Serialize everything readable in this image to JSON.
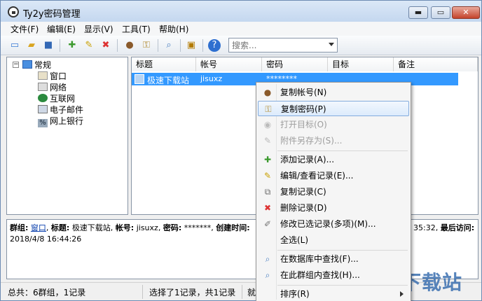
{
  "window": {
    "title": "Ty2y密码管理"
  },
  "title_buttons": {
    "minimize": "▬",
    "maximize": "▭",
    "close": "✕"
  },
  "menu": [
    "文件(F)",
    "编辑(E)",
    "显示(V)",
    "工具(T)",
    "帮助(H)"
  ],
  "toolbar": {
    "icons": [
      "new-file-icon",
      "open-folder-icon",
      "save-icon",
      "add-record-icon",
      "edit-record-icon",
      "delete-record-icon",
      "user-icon",
      "key-icon",
      "find-icon",
      "lock-icon",
      "help-icon"
    ],
    "search_placeholder": "搜索..."
  },
  "tree": {
    "root": "常规",
    "children": [
      "窗口",
      "网络",
      "互联网",
      "电子邮件",
      "网上银行"
    ]
  },
  "list": {
    "columns": [
      "标题",
      "帐号",
      "密码",
      "目标",
      "备注"
    ],
    "rows": [
      {
        "title": "极速下载站",
        "account": "jisuxz",
        "password": "********",
        "target": "",
        "note": ""
      }
    ]
  },
  "detail": {
    "group_label": "群组:",
    "group_value": "窗口",
    "title_label": "标题:",
    "title_value": "极速下载站,",
    "account_label": "帐号:",
    "account_value": "jisuxz,",
    "password_label": "密码:",
    "password_value": "*******,",
    "created_label": "创建时间:",
    "right_time": "35:32,",
    "last_access_label": "最后访问:",
    "line2": "2018/4/8 16:44:26"
  },
  "status": {
    "summary": "总共：6群组，1记录",
    "selection": "选择了1记录，共1记录",
    "state": "就"
  },
  "context_menu": {
    "items": [
      {
        "label": "复制帐号(N)",
        "icon": "user-icon",
        "state": "normal"
      },
      {
        "label": "复制密码(P)",
        "icon": "key-icon",
        "state": "hover"
      },
      {
        "label": "打开目标(O)",
        "icon": "globe-icon",
        "state": "disabled"
      },
      {
        "label": "附件另存为(S)...",
        "icon": "attachment-icon",
        "state": "disabled"
      },
      {
        "label": "添加记录(A)...",
        "icon": "add-record-icon",
        "state": "normal"
      },
      {
        "label": "编辑/查看记录(E)...",
        "icon": "edit-record-icon",
        "state": "normal"
      },
      {
        "label": "复制记录(C)",
        "icon": "copy-record-icon",
        "state": "normal"
      },
      {
        "label": "删除记录(D)",
        "icon": "delete-record-icon",
        "state": "normal"
      },
      {
        "label": "修改已选记录(多项)(M)...",
        "icon": "multi-edit-icon",
        "state": "normal"
      },
      {
        "label": "全选(L)",
        "icon": "",
        "state": "normal"
      },
      {
        "label": "在数据库中查找(F)...",
        "icon": "find-icon",
        "state": "normal"
      },
      {
        "label": "在此群组内查找(H)...",
        "icon": "find-group-icon",
        "state": "normal"
      },
      {
        "label": "排序(R)",
        "icon": "",
        "state": "normal"
      }
    ]
  },
  "watermark": "极速下载站",
  "colors": {
    "selection": "#3399ff",
    "link": "#0b40ad",
    "accent": "#3a6fb0"
  }
}
